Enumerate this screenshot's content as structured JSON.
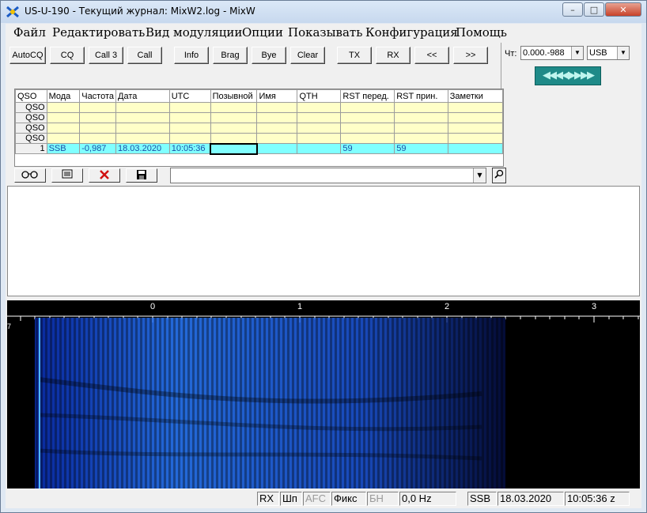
{
  "window": {
    "title": "US-U-190 - Текущий журнал: MixW2.log - MixW",
    "minimize": "–",
    "maximize": "□",
    "close": "✕"
  },
  "menu": [
    "Файл",
    "Редактировать",
    "Вид модуляции",
    "Опции",
    "Показывать",
    "Конфигурация",
    "Помощь"
  ],
  "toolbar": [
    "AutoCQ",
    "CQ",
    "Call 3",
    "Call",
    "Info",
    "Brag",
    "Bye",
    "Clear",
    "TX",
    "RX",
    "<<",
    ">>"
  ],
  "right_panel": {
    "channel_label": "Чт:",
    "frequency_value": "0.000.-988",
    "mode_value": "USB",
    "tune_arrows": "◀◀◀◀▶▶▶▶"
  },
  "log": {
    "headers": [
      "QSO",
      "Мода",
      "Частота",
      "Дата",
      "UTC",
      "Позывной",
      "Имя",
      "QTH",
      "RST перед.",
      "RST прин.",
      "Заметки"
    ],
    "prev_rows": [
      "QSO",
      "QSO",
      "QSO",
      "QSO"
    ],
    "current": {
      "qso": "1",
      "mode": "SSB",
      "freq": "-0,987",
      "date": "18.03.2020",
      "utc": "10:05:36",
      "call": "",
      "name": "",
      "qth": "",
      "rst_sent": "59",
      "rst_rcvd": "59",
      "notes": ""
    }
  },
  "log_tools": {
    "search_value": ""
  },
  "waterfall": {
    "scale_labels": [
      "0",
      "1",
      "2",
      "3"
    ],
    "left_mark": "7"
  },
  "status": {
    "rx": "RX",
    "shp": "Шп",
    "afc": "AFC",
    "fix": "Фикс",
    "nb": "БН",
    "offset": "0,0 Hz",
    "mode": "SSB",
    "date": "18.03.2020",
    "time": "10:05:36 z"
  },
  "colors": {
    "log_rows": "#ffffc8",
    "current_row": "#80ffff",
    "waterfall_signal": "#2a6cff",
    "tune_button": "#1f8a88"
  }
}
